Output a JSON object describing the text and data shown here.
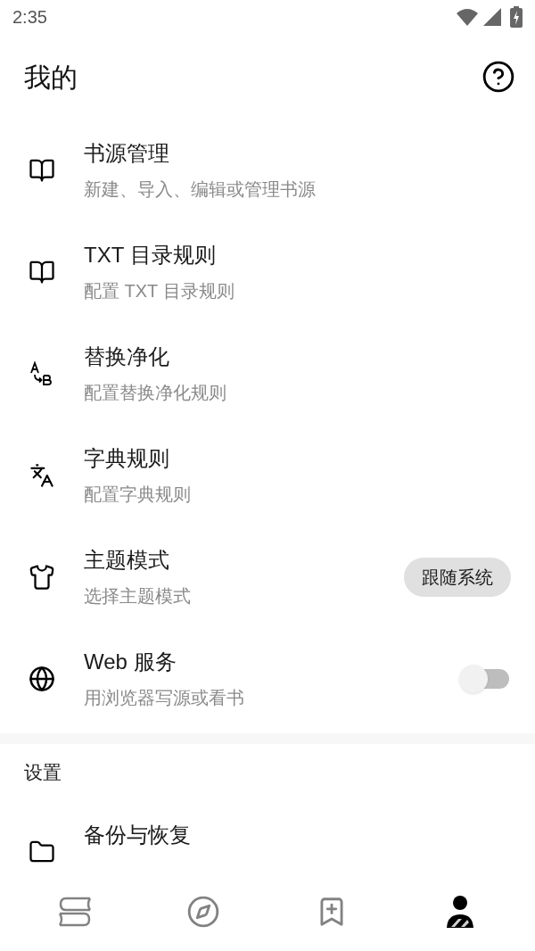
{
  "status_bar": {
    "time": "2:35"
  },
  "header": {
    "title": "我的"
  },
  "items": [
    {
      "kind": "plain",
      "title": "书源管理",
      "summary": "新建、导入、编辑或管理书源"
    },
    {
      "kind": "plain",
      "title": "TXT 目录规则",
      "summary": "配置 TXT 目录规则"
    },
    {
      "kind": "plain",
      "title": "替换净化",
      "summary": "配置替换净化规则"
    },
    {
      "kind": "plain",
      "title": "字典规则",
      "summary": "配置字典规则"
    },
    {
      "kind": "chip",
      "title": "主题模式",
      "summary": "选择主题模式",
      "value": "跟随系统"
    },
    {
      "kind": "switch",
      "title": "Web 服务",
      "summary": "用浏览器写源或看书",
      "on": false
    }
  ],
  "section": {
    "title": "设置"
  },
  "settings_items": [
    {
      "title": "备份与恢复"
    }
  ],
  "bottom_nav": [
    {
      "selected": false
    },
    {
      "selected": false
    },
    {
      "selected": false
    },
    {
      "selected": true
    }
  ]
}
